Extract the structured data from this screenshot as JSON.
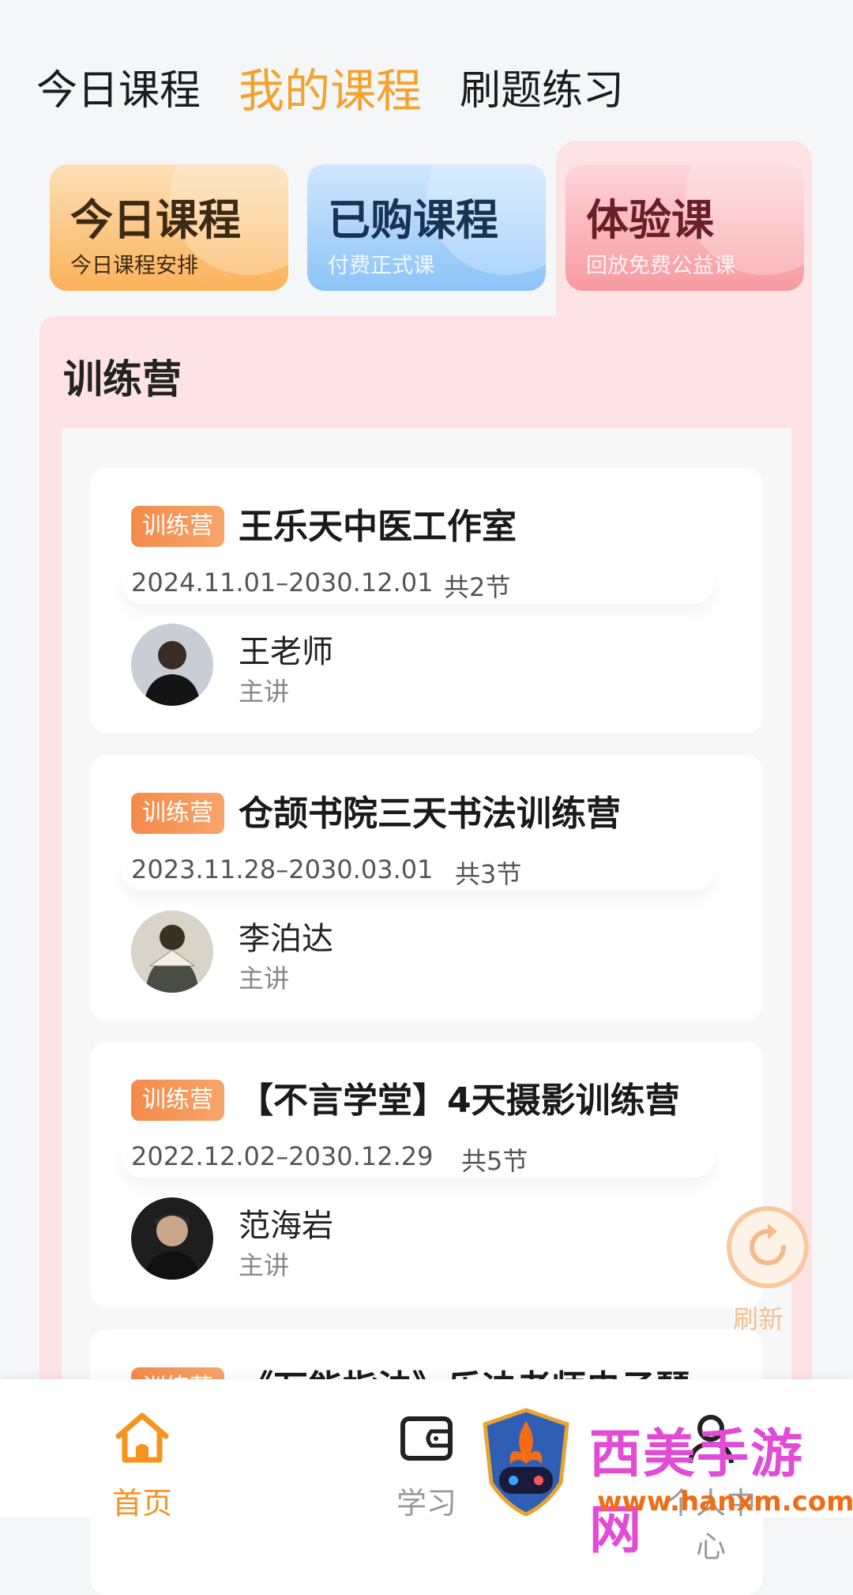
{
  "top_tabs": [
    "今日课程",
    "我的课程",
    "刷题练习"
  ],
  "categories": [
    {
      "title": "今日课程",
      "subtitle": "今日课程安排"
    },
    {
      "title": "已购课程",
      "subtitle": "付费正式课"
    },
    {
      "title": "体验课",
      "subtitle": "回放免费公益课"
    }
  ],
  "section_title": "训练营",
  "courses": [
    {
      "badge": "训练营",
      "title": "王乐天中医工作室",
      "dates": "2024.11.01–2030.12.01",
      "count": "共2节",
      "teacher": "王老师",
      "role": "主讲"
    },
    {
      "badge": "训练营",
      "title": "仓颉书院三天书法训练营",
      "dates": "2023.11.28–2030.03.01",
      "count": "共3节",
      "teacher": "李泊达",
      "role": "主讲"
    },
    {
      "badge": "训练营",
      "title": "【不言学堂】4天摄影训练营",
      "dates": "2022.12.02–2030.12.29",
      "count": "共5节",
      "teacher": "范海岩",
      "role": "主讲"
    },
    {
      "badge": "训练营",
      "title": "《万能指法》乐迪老师电子琴"
    }
  ],
  "refresh_label": "刷新",
  "bottom_nav": [
    "首页",
    "学习",
    "个人中心"
  ],
  "watermark": {
    "name": "西美手游网",
    "url": "www.hanxm.com"
  },
  "colors": {
    "accent": "#f5a12b",
    "badge": "#f58a4b",
    "panel": "#fde3e4"
  }
}
